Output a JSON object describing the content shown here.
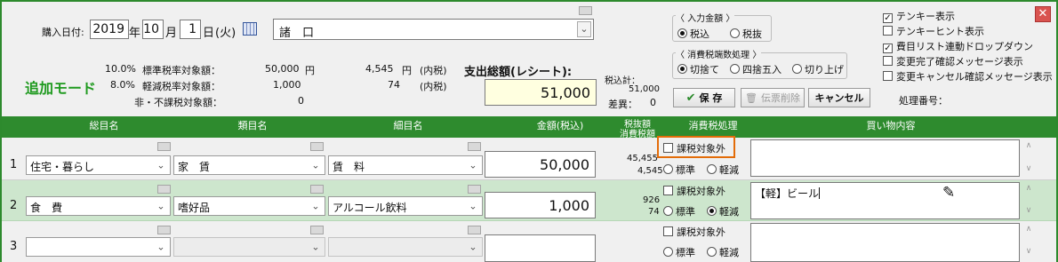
{
  "purchase": {
    "date_label": "購入日付:",
    "year": "2019",
    "year_unit": "年",
    "month": "10",
    "month_unit": "月",
    "day": "1",
    "day_unit": "日",
    "weekday": "(火)",
    "payee": "諸　口"
  },
  "mode_label": "追加モード",
  "tax_summary": {
    "rows": [
      {
        "rate": "10.0%",
        "label": "標準税率対象額：",
        "amount": "50,000",
        "unit": "円",
        "tax": "4,545",
        "tax_unit": "円",
        "note": "(内税)"
      },
      {
        "rate": "8.0%",
        "label": "軽減税率対象額：",
        "amount": "1,000",
        "unit": "",
        "tax": "74",
        "tax_unit": "",
        "note": "(内税)"
      },
      {
        "rate": "",
        "label": "非・不課税対象額：",
        "amount": "0",
        "unit": "",
        "tax": "",
        "tax_unit": "",
        "note": ""
      }
    ]
  },
  "total": {
    "label": "支出総額(レシート):",
    "value": "51,000"
  },
  "inclusive_total": {
    "label": "税込計：",
    "value": "51,000",
    "diff_label": "差異：",
    "diff_value": "0"
  },
  "input_amount": {
    "title": "〈 入力金額 〉",
    "options": [
      "税込",
      "税抜"
    ],
    "selected": 0
  },
  "rounding": {
    "title": "〈 消費税端数処理 〉",
    "options": [
      "切捨て",
      "四捨五入",
      "切り上げ"
    ],
    "selected": 0
  },
  "buttons": {
    "save": "保 存",
    "delete": "伝票削除",
    "cancel": "キャンセル"
  },
  "processing_no_label": "処理番号：",
  "options": [
    {
      "label": "テンキー表示",
      "checked": true
    },
    {
      "label": "テンキーヒント表示",
      "checked": false
    },
    {
      "label": "費目リスト連動ドロップダウン",
      "checked": true
    },
    {
      "label": "変更完了確認メッセージ表示",
      "checked": false
    },
    {
      "label": "変更キャンセル確認メッセージ表示",
      "checked": false
    }
  ],
  "table": {
    "headers": {
      "category": "総目名",
      "type": "類目名",
      "detail": "細目名",
      "amount": "金額(税込)",
      "tax_a": "税抜額",
      "tax_b": "消費税額",
      "tax_proc": "消費税処理",
      "memo": "買い物内容"
    },
    "rows": [
      {
        "no": "1",
        "category": "住宅・暮らし",
        "type": "家　賃",
        "detail": "賃　料",
        "amount": "50,000",
        "net": "45,455",
        "tax": "4,545",
        "exempt_label": "課税対象外",
        "rate_options": [
          "標準",
          "軽減"
        ],
        "rate_selected": 0,
        "memo": ""
      },
      {
        "no": "2",
        "category": "食　費",
        "type": "嗜好品",
        "detail": "アルコール飲料",
        "amount": "1,000",
        "net": "926",
        "tax": "74",
        "exempt_label": "課税対象外",
        "rate_options": [
          "標準",
          "軽減"
        ],
        "rate_selected": 1,
        "memo": "【軽】ビール"
      },
      {
        "no": "3",
        "category": "",
        "type": "",
        "detail": "",
        "amount": "",
        "net": "",
        "tax": "",
        "exempt_label": "課税対象外",
        "rate_options": [
          "標準",
          "軽減"
        ],
        "rate_selected": -1,
        "memo": ""
      }
    ]
  },
  "colors": {
    "green": "#2e8b2e",
    "mode_green": "#1f9a1f",
    "highlight_row": "#cde6cd",
    "total_bg": "#ffffe0",
    "annotation": "#e36c09"
  }
}
